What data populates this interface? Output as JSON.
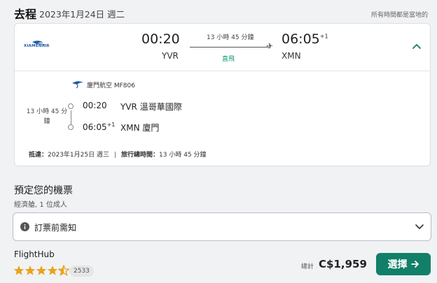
{
  "header": {
    "title": "去程",
    "date": "2023年1月24日 週二",
    "note": "所有時間都是當地的"
  },
  "flight": {
    "airline_logo_text": "XIAMENAIR",
    "departure_time": "00:20",
    "departure_code": "YVR",
    "duration": "13 小時 45 分鐘",
    "stops": "直飛",
    "arrival_time": "06:05",
    "arrival_day_offset": "+1",
    "arrival_code": "XMN"
  },
  "details": {
    "airline": "廈門航空 MF806",
    "segment_duration": "13 小時 45 分鐘",
    "depart_time": "00:20",
    "depart_place": "YVR 溫哥華國際",
    "arrive_time": "06:05",
    "arrive_day_offset": "+1",
    "arrive_place": "XMN 廈門",
    "arrival_label": "抵達：",
    "arrival_date": "2023年1月25日 週三",
    "separator": "|",
    "total_label": "旅行總時間：",
    "total_time": "13 小時 45 分鐘"
  },
  "booking": {
    "title": "預定您的機票",
    "subtitle": "經濟艙, 1 位成人",
    "notice_label": "訂票前需知"
  },
  "vendor": {
    "name": "FlightHub",
    "rating_stars": 4.5,
    "review_count": "2533",
    "total_label": "總計",
    "price": "C$1,959",
    "select_label": "選擇"
  },
  "icons": {
    "airline": "xiamen-air-logo-icon",
    "plane": "plane-icon",
    "expand": "chevron-up-icon",
    "info": "info-icon",
    "collapse": "chevron-down-icon",
    "arrow": "arrow-right-icon",
    "star": "star-icon"
  },
  "colors": {
    "accent": "#127f69",
    "direct": "#15947a",
    "star": "#e9a21a",
    "airline_blue": "#1f5aa6"
  }
}
